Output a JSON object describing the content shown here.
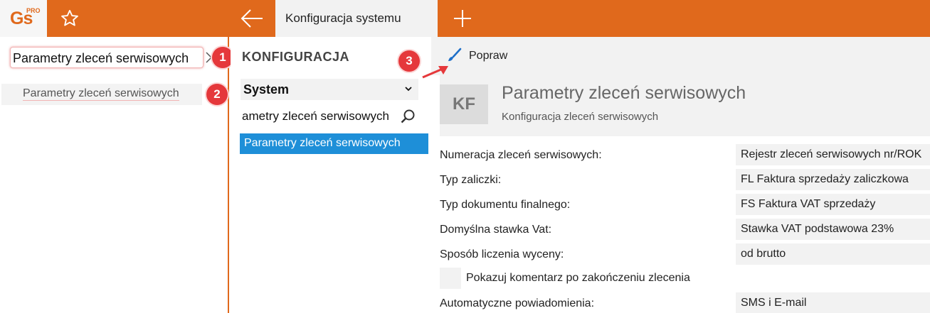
{
  "app": {
    "logo_text": "Gs",
    "logo_badge": "PRO",
    "active_tab": "Konfiguracja systemu"
  },
  "left": {
    "search_value": "Parametry zleceń serwisowych",
    "tree_item": "Parametry zleceń serwisowych"
  },
  "middle": {
    "title": "KONFIGURACJA",
    "select_value": "System",
    "search_value": "ametry zleceń serwisowych",
    "selected_item": "Parametry zleceń serwisowych"
  },
  "toolbar": {
    "edit_label": "Popraw"
  },
  "header": {
    "initials": "KF",
    "title": "Parametry zleceń serwisowych",
    "subtitle": "Konfiguracja zleceń serwisowych"
  },
  "fields": [
    {
      "label": "Numeracja zleceń serwisowych:",
      "value": "Rejestr zleceń serwisowych nr/ROK"
    },
    {
      "label": "Typ zaliczki:",
      "value": "FL  Faktura sprzedaży zaliczkowa"
    },
    {
      "label": "Typ dokumentu finalnego:",
      "value": "FS  Faktura VAT sprzedaży"
    },
    {
      "label": "Domyślna stawka Vat:",
      "value": "Stawka VAT podstawowa 23%"
    },
    {
      "label": "Sposób liczenia wyceny:",
      "value": "od brutto"
    },
    {
      "label": "Automatyczne powiadomienia:",
      "value": "SMS i E-mail"
    }
  ],
  "checkbox": {
    "label": "Pokazuj komentarz po zakończeniu zlecenia",
    "checked": false
  },
  "annotations": {
    "badge1": "1",
    "badge2": "2",
    "badge3": "3"
  },
  "colors": {
    "accent": "#e0691c",
    "selection": "#1e8fd8",
    "annotation": "#e5383b"
  },
  "icons": [
    "star-icon",
    "back-arrow-icon",
    "plus-icon",
    "close-icon",
    "chevron-down-icon",
    "search-icon",
    "brush-icon"
  ]
}
